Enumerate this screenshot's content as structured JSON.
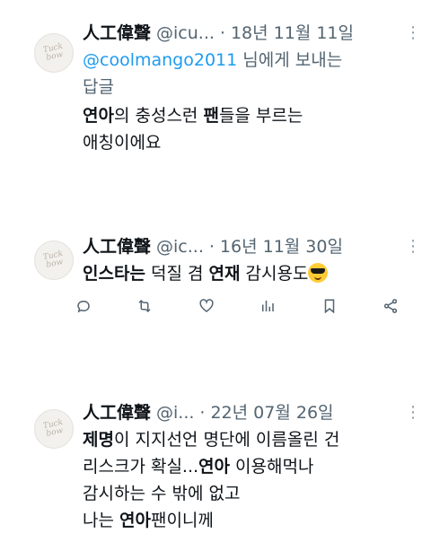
{
  "tweets": [
    {
      "name": "人工偉聲",
      "handle": "@icu...",
      "sep": "·",
      "date": "18년 11월 11일",
      "reply_mention": "@coolmango2011",
      "reply_suffix": " 님에게 보내는",
      "reply_line2": "답글",
      "line1_bold1": "연아",
      "line1_rest1": "의 충성스런 ",
      "line1_bold2": "팬",
      "line1_rest2": "들을 부르는",
      "line2": "애칭이에요"
    },
    {
      "name": "人工偉聲",
      "handle": "@ic...",
      "sep": "·",
      "date": "16년 11월 30일",
      "bold1": "인스타는",
      "rest1": " 덕질 겸 ",
      "bold2": "연재",
      "rest2": " 감시용도",
      "emoji": "smiling-face-with-sunglasses"
    },
    {
      "name": "人工偉聲",
      "handle": "@i...",
      "sep": "·",
      "date": "22년 07월 26일",
      "l1_bold": "제명",
      "l1_rest": "이 지지선언 명단에 이름올린 건",
      "l2_pre": "리스크가 확실...",
      "l2_bold": "연아",
      "l2_rest": " 이용해먹나",
      "l3": "감시하는 수 밖에 없고",
      "l4_pre": "나는 ",
      "l4_bold": "연아",
      "l4_rest": "팬이니께"
    }
  ],
  "avatar_text": "Tuck\nbow",
  "more_icon": "more-dots-icon",
  "actions": [
    "reply-icon",
    "retweet-icon",
    "like-icon",
    "views-icon",
    "bookmark-icon",
    "share-icon"
  ],
  "colors": {
    "text": "#0f1419",
    "muted": "#536471",
    "link": "#1d9bf0"
  }
}
